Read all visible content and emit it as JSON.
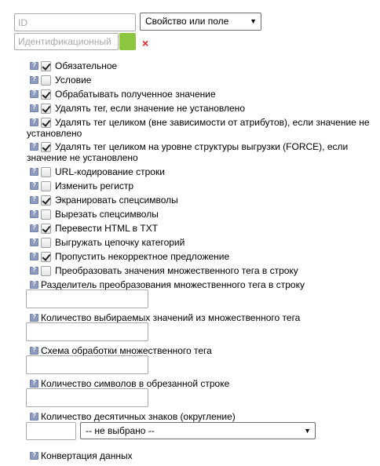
{
  "header": {
    "id_placeholder": "ID",
    "property_select": "Свойство или поле",
    "identifier_placeholder": "Идентификационный номер",
    "remove_symbol": "×"
  },
  "options": [
    {
      "label": "Обязательное",
      "checked": true
    },
    {
      "label": "Условие",
      "checked": false
    },
    {
      "label": "Обрабатывать полученное значение",
      "checked": true
    },
    {
      "label": "Удалять тег, если значение не установлено",
      "checked": true
    },
    {
      "label": "Удалять тег целиком (вне зависимости от атрибутов), если значение не установлено",
      "checked": true
    },
    {
      "label": "Удалять тег целиком на уровне структуры выгрузки (FORCE), если значение не установлено",
      "checked": true
    },
    {
      "label": "URL-кодирование строки",
      "checked": false
    },
    {
      "label": "Изменить регистр",
      "checked": false
    },
    {
      "label": "Экранировать спецсимволы",
      "checked": true
    },
    {
      "label": "Вырезать спецсимволы",
      "checked": false
    },
    {
      "label": "Перевести HTML в TXT",
      "checked": true
    },
    {
      "label": "Выгружать цепочку категорий",
      "checked": false
    },
    {
      "label": "Пропустить некорректное предложение",
      "checked": true
    },
    {
      "label": "Преобразовать значения множественного тега в строку",
      "checked": false
    }
  ],
  "fields": {
    "separator_label": "Разделитель преобразования множественного тега в строку",
    "separator_value": "",
    "count_label": "Количество выбираемых значений из множественного тега",
    "count_value": "",
    "scheme_label": "Схема обработки множественного тега",
    "scheme_value": "",
    "symbols_label": "Количество символов в обрезанной строке",
    "symbols_value": "",
    "decimals_label": "Количество десятичных знаков (округление)",
    "decimals_value": "",
    "decimals_select": "-- не выбрано --",
    "conversion_label": "Конвертация данных"
  },
  "icons": {
    "help": "help-icon",
    "select_arrow": "▼",
    "checkmark": "checkmark-icon"
  }
}
